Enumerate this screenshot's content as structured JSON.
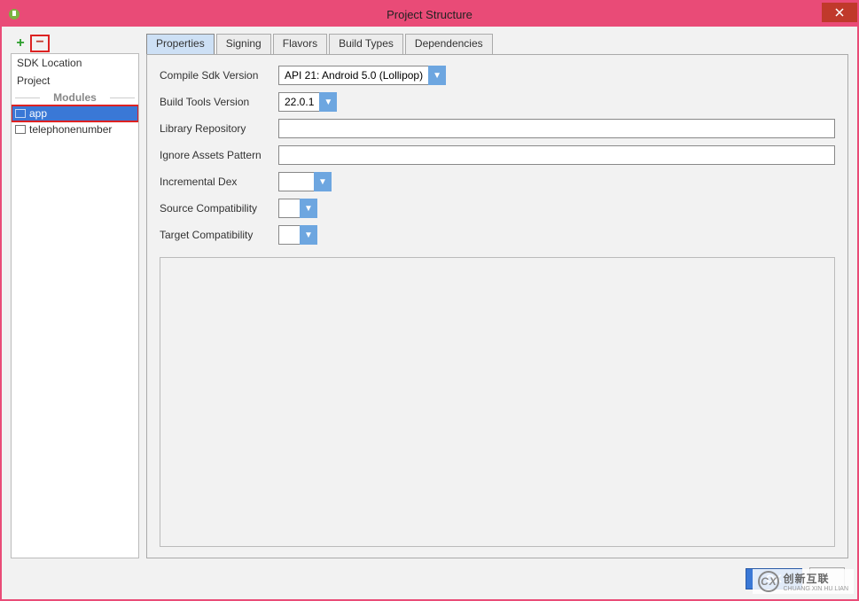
{
  "window": {
    "title": "Project Structure"
  },
  "sidebar": {
    "items": [
      "SDK Location",
      "Project"
    ],
    "section_label": "Modules",
    "modules": [
      "app",
      "telephonenumber"
    ],
    "selected": "app"
  },
  "tabs": [
    "Properties",
    "Signing",
    "Flavors",
    "Build Types",
    "Dependencies"
  ],
  "active_tab": "Properties",
  "form": {
    "compile_sdk_label": "Compile Sdk Version",
    "compile_sdk_value": "API 21: Android 5.0 (Lollipop)",
    "build_tools_label": "Build Tools Version",
    "build_tools_value": "22.0.1",
    "library_repo_label": "Library Repository",
    "library_repo_value": "",
    "ignore_assets_label": "Ignore Assets Pattern",
    "ignore_assets_value": "",
    "incremental_dex_label": "Incremental Dex",
    "incremental_dex_value": "",
    "source_compat_label": "Source Compatibility",
    "source_compat_value": "",
    "target_compat_label": "Target Compatibility",
    "target_compat_value": ""
  },
  "buttons": {
    "ok": "OK",
    "cancel": ""
  },
  "watermark": {
    "text": "创新互联",
    "sub": "CHUANG XIN HU LIAN"
  }
}
